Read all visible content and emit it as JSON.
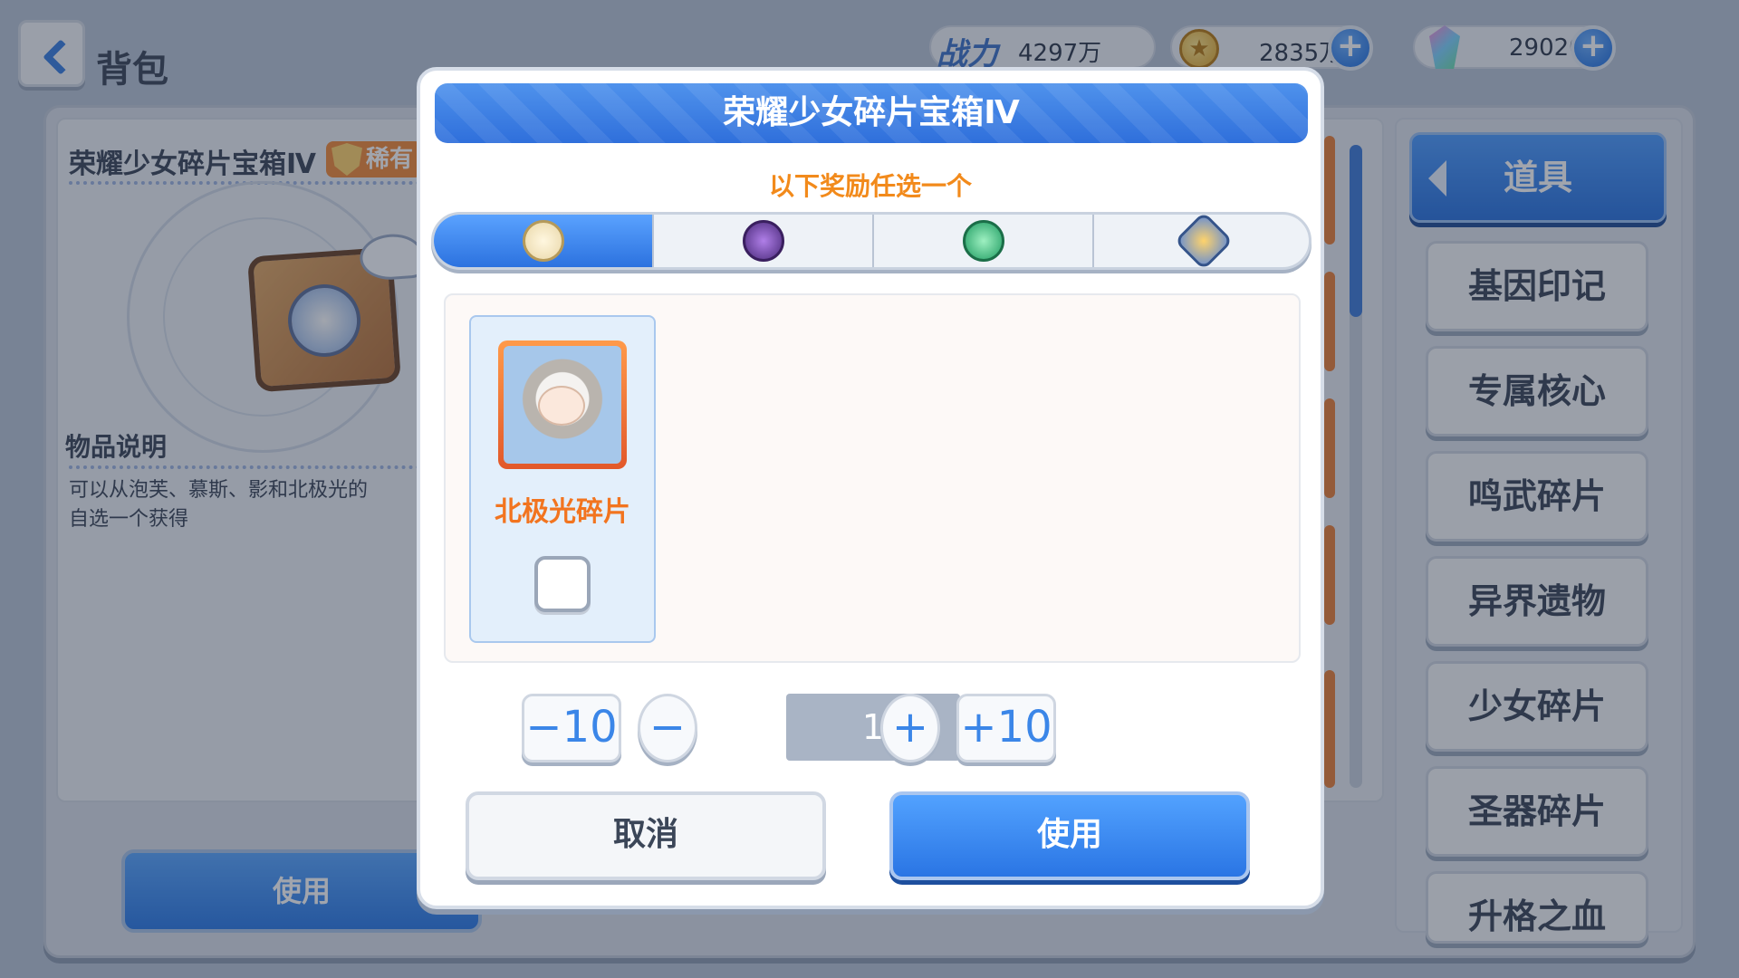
{
  "header": {
    "back_title": "背包"
  },
  "currency": {
    "power_label": "战力",
    "power_value": "4297万",
    "coins": "2835万",
    "gems": "29020",
    "plus_symbol": "+"
  },
  "item_panel": {
    "title": "荣耀少女碎片宝箱Ⅳ",
    "rarity": "稀有",
    "desc_heading": "物品说明",
    "desc_text": "可以从泡芙、慕斯、影和北极光的",
    "desc_text2": "自选一个获得",
    "use_label": "使用"
  },
  "sidebar": {
    "main_tab": "道具",
    "categories": [
      "基因印记",
      "专属核心",
      "鸣武碎片",
      "异界遗物",
      "少女碎片",
      "圣器碎片",
      "升格之血"
    ]
  },
  "modal": {
    "title": "荣耀少女碎片宝箱Ⅳ",
    "subtitle": "以下奖励任选一个",
    "tabs": [
      {
        "icon": "wing-emblem-icon",
        "active": true
      },
      {
        "icon": "dark-star-icon",
        "active": false
      },
      {
        "icon": "leaf-orb-icon",
        "active": false
      },
      {
        "icon": "hexagon-emblem-icon",
        "active": false
      }
    ],
    "reward": {
      "name": "北极光碎片",
      "checked": false
    },
    "stepper": {
      "minus10": "−10",
      "minus": "−",
      "qty": "1",
      "plus": "+",
      "plus10": "+10"
    },
    "cancel_label": "取消",
    "use_label": "使用"
  }
}
